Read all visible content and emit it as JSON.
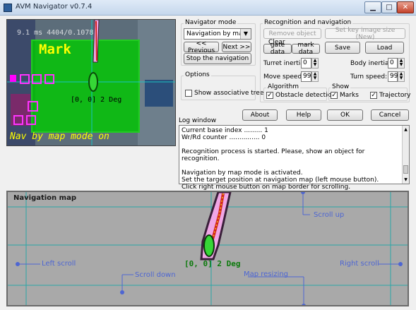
{
  "window": {
    "title": "AVM Navigator v0.7.4",
    "min_glyph": "▁",
    "max_glyph": "□",
    "close_glyph": "✕"
  },
  "camera": {
    "fps_text": "9.1 ms  4404/0.1078",
    "mark_label": "Mark",
    "position_text": "[0, 0] 2 Deg",
    "mode_text": "Nav by map mode on"
  },
  "navigator_mode": {
    "legend": "Navigator mode",
    "selected": "Navigation by map",
    "previous_label": "<< Previous",
    "next_label": "Next >>",
    "stop_label": "Stop the navigation"
  },
  "options": {
    "legend": "Options",
    "show_tree_label": "Show associative tree",
    "show_tree_checked": false
  },
  "recognition": {
    "legend": "Recognition and navigation",
    "remove_object_label": "Remove object",
    "set_key_image_label": "Set key image size (New)",
    "clear_label": "Clear",
    "gate_data_label": "gate data",
    "mark_data_label": "mark data",
    "save_label": "Save",
    "load_label": "Load",
    "turret_inertia_label": "Turret inertia:",
    "turret_inertia_value": "0",
    "body_inertia_label": "Body inertia:",
    "body_inertia_value": "0",
    "move_speed_label": "Move speed:",
    "move_speed_value": "99",
    "turn_speed_label": "Turn speed:",
    "turn_speed_value": "99",
    "algorithm_legend": "Algorithm",
    "obstacle_label": "Obstacle detection",
    "obstacle_checked": true,
    "show_legend": "Show",
    "marks_label": "Marks",
    "marks_checked": true,
    "trajectory_label": "Trajectory",
    "trajectory_checked": true
  },
  "actions": {
    "about_label": "About",
    "help_label": "Help",
    "ok_label": "OK",
    "cancel_label": "Cancel"
  },
  "log": {
    "title": "Log window",
    "lines": [
      "Current base index ......... 1",
      "Wr/Rd counter ............... 0",
      "",
      "Recognition process is started. Please, show an object for recognition.",
      "",
      "Navigation by map mode is activated.",
      "Set the target position at navigation map (left mouse button).",
      "Click right mouse button on map border for scrolling."
    ]
  },
  "navmap": {
    "title": "Navigation map",
    "position_text": "[0, 0] 2 Deg",
    "annotations": {
      "scroll_up": "Scroll up",
      "left_scroll": "Left scroll",
      "scroll_down": "Scroll down",
      "map_resizing": "Map resizing",
      "right_scroll": "Right scroll"
    }
  },
  "colors": {
    "annotation": "#4e66d2",
    "grid_line": "#2aa8a8",
    "trajectory_outer": "#3a1f3a",
    "trajectory_fill": "#f0a6e6",
    "trajectory_center": "#d2241b",
    "robot": "#36d736",
    "overlay_green": "#00c800",
    "text_yellow": "#ffff00"
  }
}
